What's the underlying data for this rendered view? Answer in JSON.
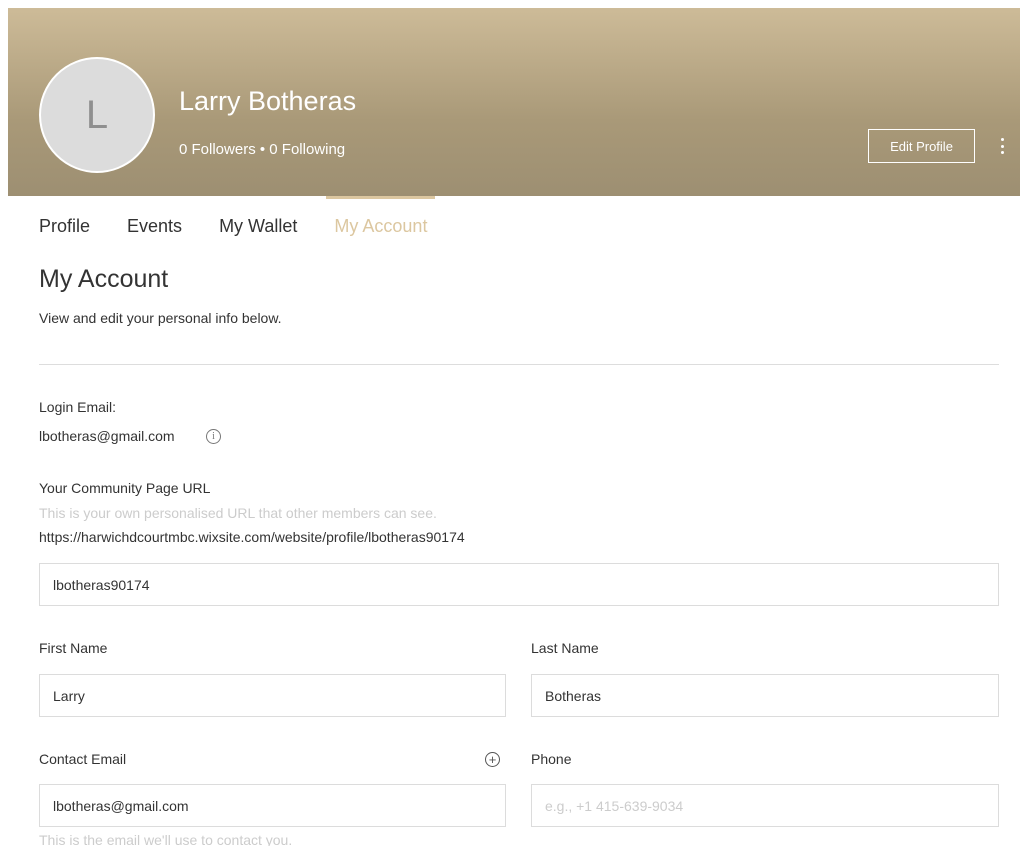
{
  "profile": {
    "avatar_letter": "L",
    "name": "Larry Botheras",
    "follow_line": "0 Followers • 0 Following",
    "edit_button": "Edit Profile",
    "more_icon": "vertical-dots-icon"
  },
  "tabs": [
    {
      "label": "Profile",
      "active": false
    },
    {
      "label": "Events",
      "active": false
    },
    {
      "label": "My Wallet",
      "active": false
    },
    {
      "label": "My Account",
      "active": true
    }
  ],
  "account": {
    "title": "My Account",
    "subtitle": "View and edit your personal info below.",
    "login_email_label": "Login Email:",
    "login_email": "lbotheras@gmail.com",
    "info_icon": "info-icon",
    "community_url_label": "Your Community Page URL",
    "community_url_hint": "This is your own personalised URL that other members can see.",
    "community_url": "https://harwichdcourtmbc.wixsite.com/website/profile/lbotheras90174",
    "slug_value": "lbotheras90174",
    "first_name_label": "First Name",
    "first_name": "Larry",
    "last_name_label": "Last Name",
    "last_name": "Botheras",
    "contact_email_label": "Contact Email",
    "contact_email": "lbotheras@gmail.com",
    "contact_email_hint": "This is the email we'll use to contact you.",
    "add_icon": "plus-circle-icon",
    "phone_label": "Phone",
    "phone_placeholder": "e.g., +1 415-639-9034"
  },
  "colors": {
    "header_gradient_top": "#cdbb98",
    "header_gradient_bottom": "#9d8f72",
    "accent": "#dcc7a0"
  }
}
